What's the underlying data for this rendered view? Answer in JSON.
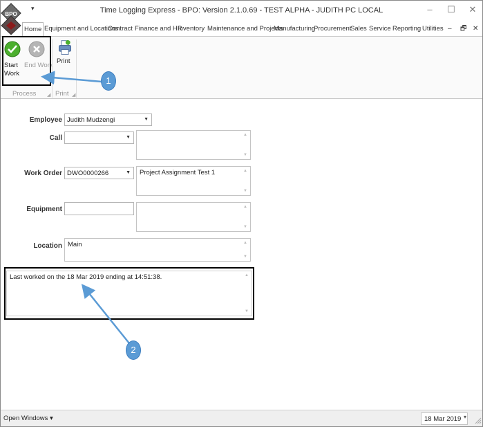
{
  "window": {
    "title": "Time Logging Express - BPO: Version 2.1.0.69 - TEST ALPHA - JUDITH PC LOCAL",
    "qat_arrow": "▾",
    "minimize": "–",
    "maximize": "☐",
    "close": "✕",
    "logo_text": "BPO"
  },
  "tabs": [
    {
      "label": "Home"
    },
    {
      "label": "Equipment and Locations"
    },
    {
      "label": "Contract"
    },
    {
      "label": "Finance and HR"
    },
    {
      "label": "Inventory"
    },
    {
      "label": "Maintenance and Projects"
    },
    {
      "label": "Manufacturing"
    },
    {
      "label": "Procurement"
    },
    {
      "label": "Sales"
    },
    {
      "label": "Service"
    },
    {
      "label": "Reporting"
    },
    {
      "label": "Utilities"
    }
  ],
  "tab_controls": {
    "minimize": "–",
    "restore": "🗗",
    "close": "✕"
  },
  "ribbon": {
    "start_work": {
      "line1": "Start",
      "line2": "Work"
    },
    "end_work": {
      "label": "End Work"
    },
    "print": {
      "label": "Print"
    },
    "groups": {
      "process": "Process",
      "print": "Print"
    },
    "launcher": "◢"
  },
  "form": {
    "employee": {
      "label": "Employee",
      "value": "Judith Mudzengi"
    },
    "call": {
      "label": "Call",
      "value": "",
      "description": ""
    },
    "work_order": {
      "label": "Work Order",
      "value": "DWO0000266",
      "description": "Project Assignment Test 1"
    },
    "equipment": {
      "label": "Equipment",
      "value": "",
      "description": ""
    },
    "location": {
      "label": "Location",
      "value": "Main"
    },
    "message": "Last worked on the 18 Mar 2019 ending at 14:51:38.",
    "dropdown_arrow": "▼",
    "scroll_up": "▲",
    "scroll_down": "▼"
  },
  "statusbar": {
    "open_windows": "Open Windows ▾",
    "date": "18 Mar 2019",
    "date_arrow": "▾"
  },
  "annotations": {
    "callout1": "1",
    "callout2": "2"
  },
  "colors": {
    "accent_green": "#4caf2e",
    "callout_blue": "#5b9bd5",
    "disabled_gray": "#9a9a9a"
  }
}
